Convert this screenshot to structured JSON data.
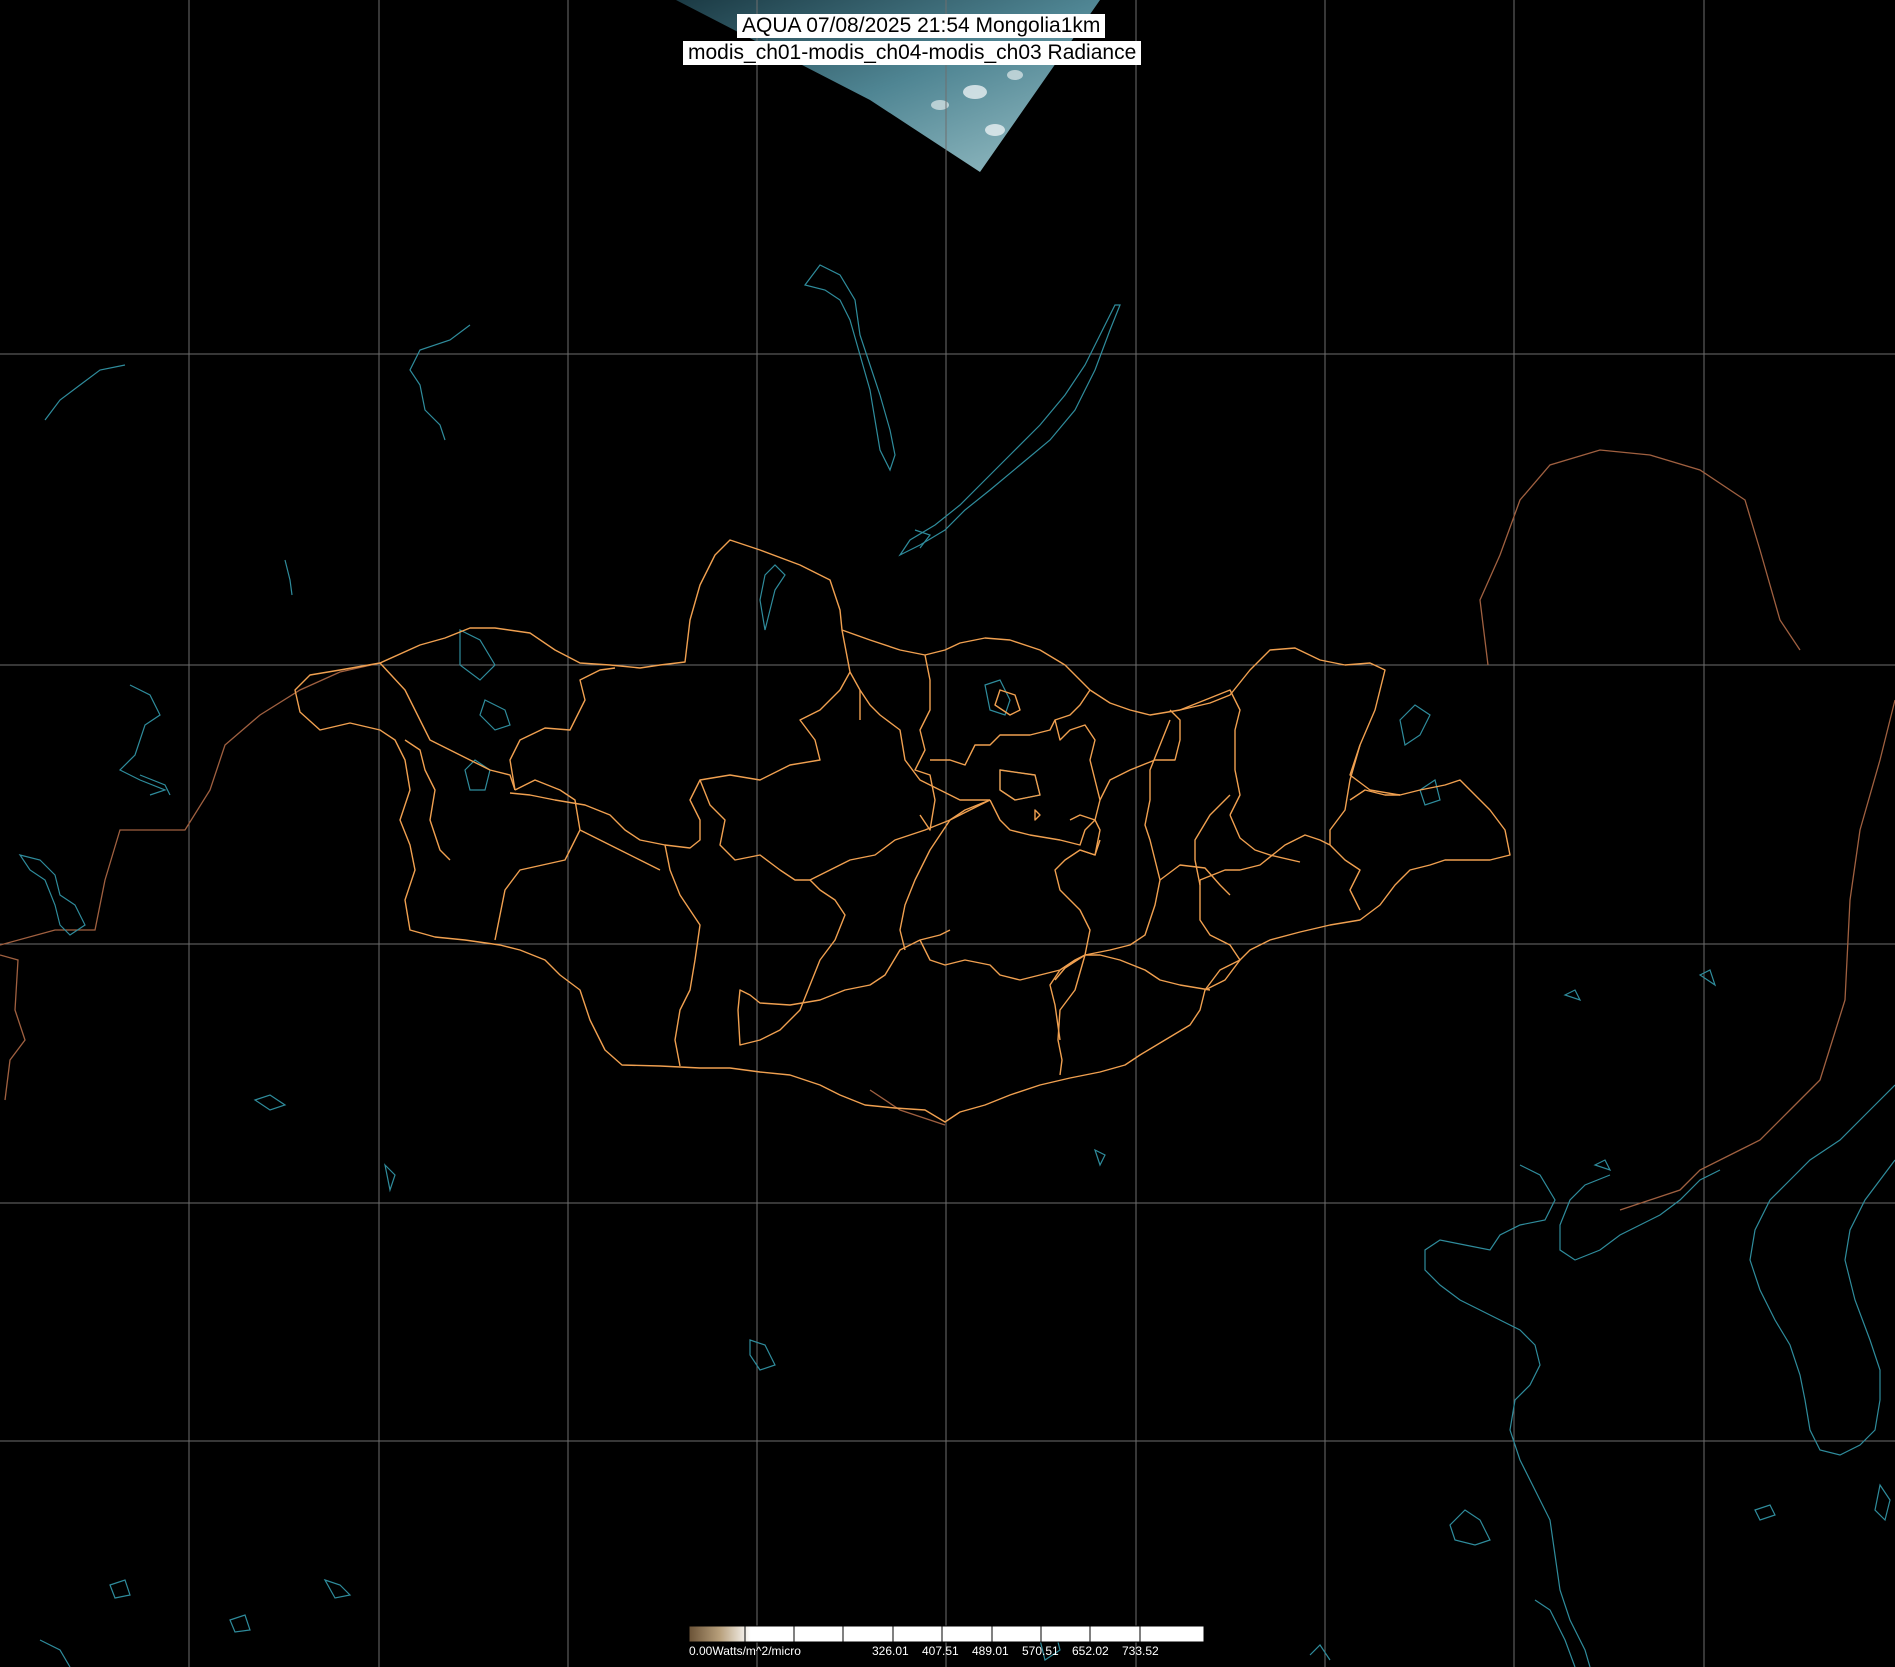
{
  "title": {
    "line1": "AQUA 07/08/2025 21:54 Mongolia1km",
    "line2": "modis_ch01-modis_ch04-modis_ch03 Radiance"
  },
  "colorbar": {
    "unit_label": "0.00Watts/m^2/micro",
    "ticks": [
      "326.01",
      "407.51",
      "489.01",
      "570.51",
      "652.02",
      "733.52"
    ],
    "colors": [
      "#6a5236",
      "#b8a07c",
      "#ffffff"
    ]
  },
  "colors": {
    "background": "#000000",
    "grid": "#6e6e6e",
    "province_border": "#f0a050",
    "international_border": "#a06040",
    "coastline": "#2f8c9c"
  }
}
